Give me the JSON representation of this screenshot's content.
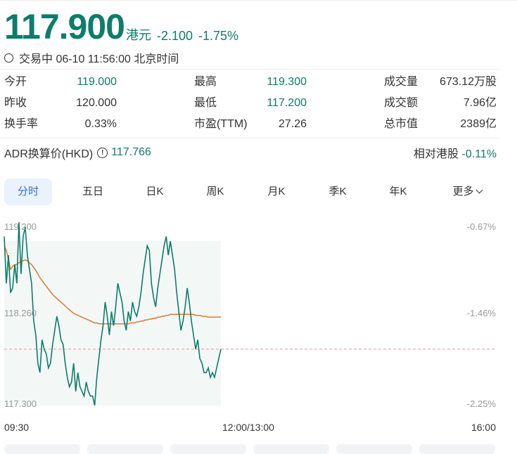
{
  "quote": {
    "price": "117.900",
    "currency": "港元",
    "change": "-2.100",
    "change_pct": "-1.75%",
    "status": "交易中 06-10 11:56:00 北京时间"
  },
  "stats": [
    {
      "label": "今开",
      "value": "119.000",
      "color": "green"
    },
    {
      "label": "最高",
      "value": "119.300",
      "color": "green"
    },
    {
      "label": "成交量",
      "value": "673.12万股",
      "color": "plain"
    },
    {
      "label": "昨收",
      "value": "120.000",
      "color": "plain"
    },
    {
      "label": "最低",
      "value": "117.200",
      "color": "green"
    },
    {
      "label": "成交额",
      "value": "7.96亿",
      "color": "plain"
    },
    {
      "label": "换手率",
      "value": "0.33%",
      "color": "plain"
    },
    {
      "label": "市盈(TTM)",
      "value": "27.26",
      "color": "plain"
    },
    {
      "label": "总市值",
      "value": "2389亿",
      "color": "plain"
    }
  ],
  "adr": {
    "label": "ADR换算价(HKD)",
    "info_icon": "info-icon",
    "value": "117.766",
    "relative_label": "相对港股",
    "relative_value": "-0.11%"
  },
  "tabs": [
    "分时",
    "五日",
    "日K",
    "周K",
    "月K",
    "季K",
    "年K",
    "更多"
  ],
  "active_tab": "分时",
  "colors": {
    "up_down_green": "#0e7c6b",
    "avg_line": "#e5782b",
    "baseline": "#f0a0a0",
    "active_tab": "#3a6fd8"
  },
  "chart_data": {
    "type": "line",
    "y_labels_left": [
      "119.200",
      "118.260",
      "117.300"
    ],
    "y_labels_right": [
      "-0.67%",
      "-1.46%",
      "-2.25%"
    ],
    "x_labels": [
      "09:30",
      "12:00/13:00",
      "16:00"
    ],
    "ylim": [
      117.3,
      119.2
    ],
    "prev_close": 120.0,
    "reference_line": 117.9,
    "series": [
      {
        "values": [
          119.1,
          118.6,
          118.9,
          118.5,
          118.55,
          118.8,
          118.6,
          119.25,
          118.7,
          119.1,
          119.2,
          118.9,
          118.75,
          118.6,
          118.2,
          118.05,
          117.75,
          117.65,
          118.0,
          117.9,
          117.85,
          117.7,
          117.75,
          117.95,
          118.1,
          118.25,
          118.15,
          118.0,
          117.95,
          117.75,
          117.6,
          117.5,
          117.55,
          117.75,
          117.45,
          117.65,
          117.5,
          117.45,
          117.4,
          117.55,
          117.45,
          117.4,
          117.4,
          117.3,
          117.6,
          117.8,
          118.0,
          118.15,
          118.4,
          118.25,
          118.05,
          118.3,
          118.15,
          118.35,
          118.6,
          118.5,
          118.4,
          118.2,
          118.1,
          118.3,
          118.2,
          118.4,
          118.3,
          118.25,
          118.35,
          118.5,
          118.7,
          118.85,
          119.0,
          118.95,
          118.6,
          118.45,
          118.35,
          118.55,
          118.7,
          118.85,
          119.0,
          119.1,
          118.9,
          119.05,
          118.9,
          118.75,
          118.5,
          118.3,
          118.1,
          118.2,
          118.35,
          118.55,
          118.4,
          118.2,
          118.05,
          117.9,
          118.0,
          117.8,
          117.75,
          117.65,
          117.65,
          117.7,
          117.6,
          117.65,
          117.6,
          117.7,
          117.8,
          117.9
        ],
        "avg": [
          119.0,
          118.95,
          118.85,
          118.75,
          118.78,
          118.8,
          118.8,
          118.82,
          118.83,
          118.84,
          118.85,
          118.84,
          118.82,
          118.8,
          118.77,
          118.74,
          118.7,
          118.66,
          118.63,
          118.6,
          118.57,
          118.54,
          118.51,
          118.48,
          118.46,
          118.44,
          118.42,
          118.4,
          118.38,
          118.36,
          118.34,
          118.32,
          118.3,
          118.28,
          118.27,
          118.26,
          118.25,
          118.24,
          118.23,
          118.22,
          118.21,
          118.2,
          118.19,
          118.18,
          118.18,
          118.17,
          118.17,
          118.17,
          118.17,
          118.17,
          118.17,
          118.17,
          118.17,
          118.17,
          118.17,
          118.17,
          118.17,
          118.17,
          118.17,
          118.17,
          118.18,
          118.18,
          118.18,
          118.19,
          118.19,
          118.2,
          118.2,
          118.21,
          118.21,
          118.22,
          118.22,
          118.23,
          118.23,
          118.24,
          118.24,
          118.25,
          118.25,
          118.26,
          118.26,
          118.27,
          118.27,
          118.27,
          118.27,
          118.27,
          118.27,
          118.27,
          118.27,
          118.27,
          118.27,
          118.27,
          118.27,
          118.26,
          118.26,
          118.26,
          118.25,
          118.25,
          118.25,
          118.24,
          118.24,
          118.24,
          118.24,
          118.24,
          118.24,
          118.24
        ]
      }
    ]
  }
}
